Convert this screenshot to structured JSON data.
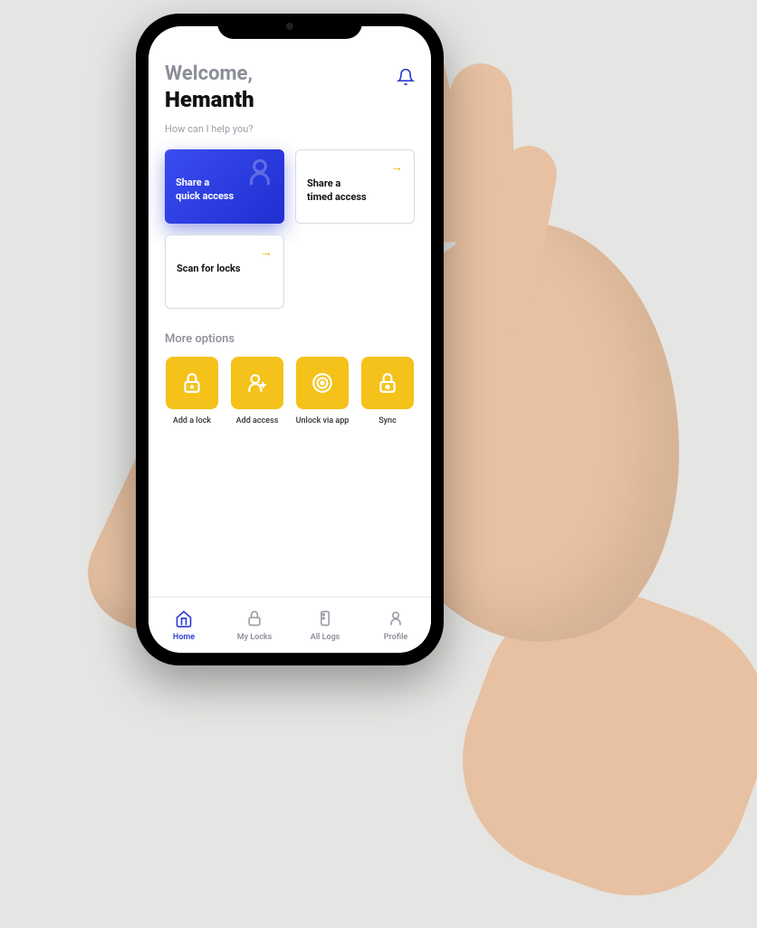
{
  "header": {
    "welcome": "Welcome,",
    "username": "Hemanth",
    "subtitle": "How can I help you?"
  },
  "action_cards": [
    {
      "label_line1": "Share a",
      "label_line2": "quick access",
      "style": "primary"
    },
    {
      "label_line1": "Share a",
      "label_line2": "timed access",
      "style": "outline"
    },
    {
      "label_line1": "Scan for locks",
      "label_line2": "",
      "style": "outline"
    }
  ],
  "more_options": {
    "title": "More options",
    "items": [
      {
        "label": "Add a lock",
        "icon": "lock-plus-icon"
      },
      {
        "label": "Add access",
        "icon": "user-plus-icon"
      },
      {
        "label": "Unlock via app",
        "icon": "target-icon"
      },
      {
        "label": "Sync",
        "icon": "lock-sync-icon"
      }
    ]
  },
  "nav": [
    {
      "label": "Home",
      "icon": "home-icon",
      "active": true
    },
    {
      "label": "My Locks",
      "icon": "lock-icon",
      "active": false
    },
    {
      "label": "All Logs",
      "icon": "logs-icon",
      "active": false
    },
    {
      "label": "Profile",
      "icon": "profile-icon",
      "active": false
    }
  ],
  "colors": {
    "accent_blue": "#2d3ccf",
    "accent_yellow": "#f4c21a"
  }
}
